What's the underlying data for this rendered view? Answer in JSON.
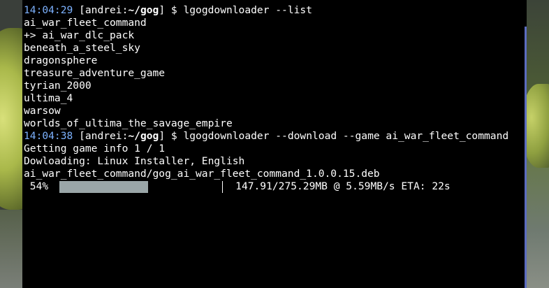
{
  "terminal": {
    "prompt1": {
      "time": "14:04:29",
      "user": "[andrei:",
      "path": "~/gog",
      "close": "]",
      "cmd": " $ lgogdownloader --list"
    },
    "list_items": [
      "ai_war_fleet_command",
      "+> ai_war_dlc_pack",
      "beneath_a_steel_sky",
      "dragonsphere",
      "treasure_adventure_game",
      "tyrian_2000",
      "ultima_4",
      "warsow",
      "worlds_of_ultima_the_savage_empire"
    ],
    "prompt2": {
      "time": "14:04:38",
      "user": "[andrei:",
      "path": "~/gog",
      "close": "]",
      "cmd": " $ lgogdownloader --download --game ai_war_fleet_command"
    },
    "output": [
      "Getting game info 1 / 1",
      "Dowloading: Linux Installer, English",
      "ai_war_fleet_command/gog_ai_war_fleet_command_1.0.0.15.deb"
    ],
    "progress": {
      "percent_label": " 54%",
      "fraction": 0.54,
      "stats": "147.91/275.29MB @ 5.59MB/s ETA: 22s"
    }
  },
  "colors": {
    "background": "#000000",
    "text": "#ffffff",
    "timestamp": "#7db2ff",
    "progress_fill": "#9aa6a8",
    "scrollbar": "#5b6cc0"
  }
}
